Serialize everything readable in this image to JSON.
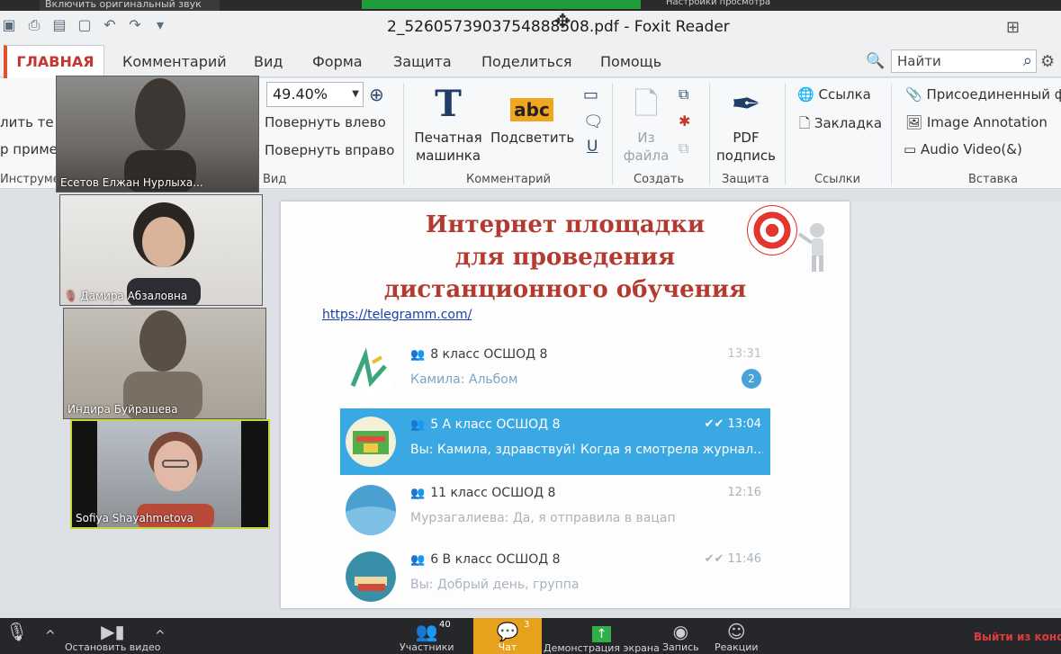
{
  "zoom_top": {
    "original_sound": "Включить оригинальный звук",
    "view_options": "Настройки просмотра"
  },
  "titlebar": {
    "title": "2_5260573903754888508.pdf - Foxit Reader"
  },
  "tabs": [
    {
      "label": "ГЛАВНАЯ"
    },
    {
      "label": "Комментарий"
    },
    {
      "label": "Вид"
    },
    {
      "label": "Форма"
    },
    {
      "label": "Защита"
    },
    {
      "label": "Поделиться"
    },
    {
      "label": "Помощь"
    }
  ],
  "search": {
    "placeholder": "Найти"
  },
  "ribbon": {
    "tools_partial": [
      "лить те",
      "р приме",
      "Инструме"
    ],
    "zoom_value": "49.40%",
    "rotate_left": "Повернуть влево",
    "rotate_right": "Повернуть вправо",
    "view_group": "Вид",
    "typewriter_line1": "Печатная",
    "typewriter_line2": "машинка",
    "highlight": "Подсветить",
    "comment_group": "Комментарий",
    "from_file_line1": "Из",
    "from_file_line2": "файла",
    "create_group": "Создать",
    "pdf_sign_line1": "PDF",
    "pdf_sign_line2": "подпись",
    "protect_group": "Защита",
    "link": "Ссылка",
    "bookmark": "Закладка",
    "links_group": "Ссылки",
    "attached_file": "Присоединенный ф",
    "image_annotation": "Image Annotation",
    "audio_video": "Audio  Video(&)",
    "insert_group": "Вставка"
  },
  "slide": {
    "title_lines": [
      "Интернет площадки",
      "для проведения",
      "дистанционного обучения"
    ],
    "url": "https://telegramm.com/",
    "chats": [
      {
        "name": "8 класс ОСШОД 8",
        "message": "Камила: Альбом",
        "time": "13:31",
        "badge": "2"
      },
      {
        "name": "5 А класс ОСШОД 8",
        "message": "Вы: Камила, здравствуй! Когда я смотрела журнал...",
        "time": "13:04"
      },
      {
        "name": "11 класс ОСШОД 8",
        "message": "Мурзагалиева: Да, я отправила в вацап",
        "time": "12:16"
      },
      {
        "name": "6 В класс ОСШОД 8",
        "message": "Вы: Добрый день, группа",
        "time": "11:46"
      }
    ]
  },
  "participants": [
    {
      "name": "Есетов Елжан Нурлыха..."
    },
    {
      "name": "Дамира Абзаловна"
    },
    {
      "name": "Индира Буйрашева"
    },
    {
      "name": "Sofiya Shayahmetova"
    }
  ],
  "bottombar": {
    "participants_label": "Участники",
    "participants_count": "40",
    "chat_label": "Чат",
    "chat_count": "3",
    "share_label": "Демонстрация экрана",
    "record_label": "Запись",
    "reactions_label": "Реакции",
    "video_label": "Остановить видео",
    "leave_label": "Выйти из конф"
  },
  "colors": {
    "accent": "#c4352f",
    "slide_title": "#b23a2e",
    "selected_chat": "#3aa9e3",
    "share_green": "#1f9d3b",
    "chat_yellow": "#e7a21d"
  }
}
